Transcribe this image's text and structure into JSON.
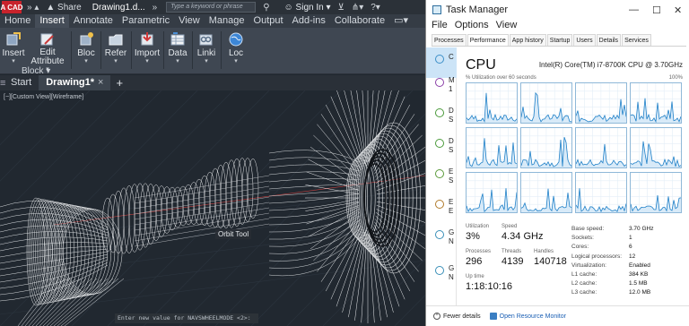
{
  "autocad": {
    "logo": "A CAD",
    "share": "Share",
    "doc_title": "Drawing1.d...",
    "search_placeholder": "Type a keyword or phrase",
    "sign_in": "Sign In",
    "ribbon_tabs": [
      "Home",
      "Insert",
      "Annotate",
      "Parametric",
      "View",
      "Manage",
      "Output",
      "Add-ins",
      "Collaborate"
    ],
    "active_ribbon_tab": "Insert",
    "ribbon_buttons": [
      {
        "label": "Insert",
        "icon": "insert-block-icon"
      },
      {
        "label": "Edit\nAttribute",
        "icon": "edit-attribute-icon"
      },
      {
        "label": "Bloc",
        "icon": "block-definition-icon"
      },
      {
        "label": "Refer",
        "icon": "reference-icon"
      },
      {
        "label": "Import",
        "icon": "import-icon"
      },
      {
        "label": "Data",
        "icon": "data-icon"
      },
      {
        "label": "Linki",
        "icon": "linking-icon"
      },
      {
        "label": "Loc",
        "icon": "location-globe-icon"
      }
    ],
    "ribbon_panel_title": "Block",
    "doc_tabs": [
      {
        "label": "Start",
        "active": false
      },
      {
        "label": "Drawing1*",
        "active": true
      }
    ],
    "viewport_label": "[−][Custom View][Wireframe]",
    "orbit_tooltip": "Orbit Tool",
    "command_line": "Enter new value for NAVSWHEELMODE <2>:"
  },
  "taskmanager": {
    "title": "Task Manager",
    "menu": [
      "File",
      "Options",
      "View"
    ],
    "tabs": [
      "Processes",
      "Performance",
      "App history",
      "Startup",
      "Users",
      "Details",
      "Services"
    ],
    "active_tab": "Performance",
    "side_labels": [
      "C",
      "M",
      "D",
      "D",
      "E",
      "E",
      "G",
      "G"
    ],
    "side_letters": [
      "",
      "1",
      "S",
      "S",
      "S",
      "E",
      "N",
      "N"
    ],
    "cpu": {
      "heading": "CPU",
      "model": "Intel(R) Core(TM) i7-8700K CPU @ 3.70GHz",
      "util_label": "% Utilization over 60 seconds",
      "util_max": "100%",
      "graph_count": 12
    },
    "stats": {
      "utilization_label": "Utilization",
      "utilization": "3%",
      "speed_label": "Speed",
      "speed": "4.34 GHz",
      "processes_label": "Processes",
      "processes": "296",
      "threads_label": "Threads",
      "threads": "4139",
      "handles_label": "Handles",
      "handles": "140718",
      "uptime_label": "Up time",
      "uptime": "1:18:10:16"
    },
    "specs": [
      {
        "k": "Base speed:",
        "v": "3.70 GHz"
      },
      {
        "k": "Sockets:",
        "v": "1"
      },
      {
        "k": "Cores:",
        "v": "6"
      },
      {
        "k": "Logical processors:",
        "v": "12"
      },
      {
        "k": "Virtualization:",
        "v": "Enabled"
      },
      {
        "k": "L1 cache:",
        "v": "384 KB"
      },
      {
        "k": "L2 cache:",
        "v": "1.5 MB"
      },
      {
        "k": "L3 cache:",
        "v": "12.0 MB"
      }
    ],
    "footer": {
      "fewer_details": "Fewer details",
      "open_monitor": "Open Resource Monitor"
    }
  }
}
